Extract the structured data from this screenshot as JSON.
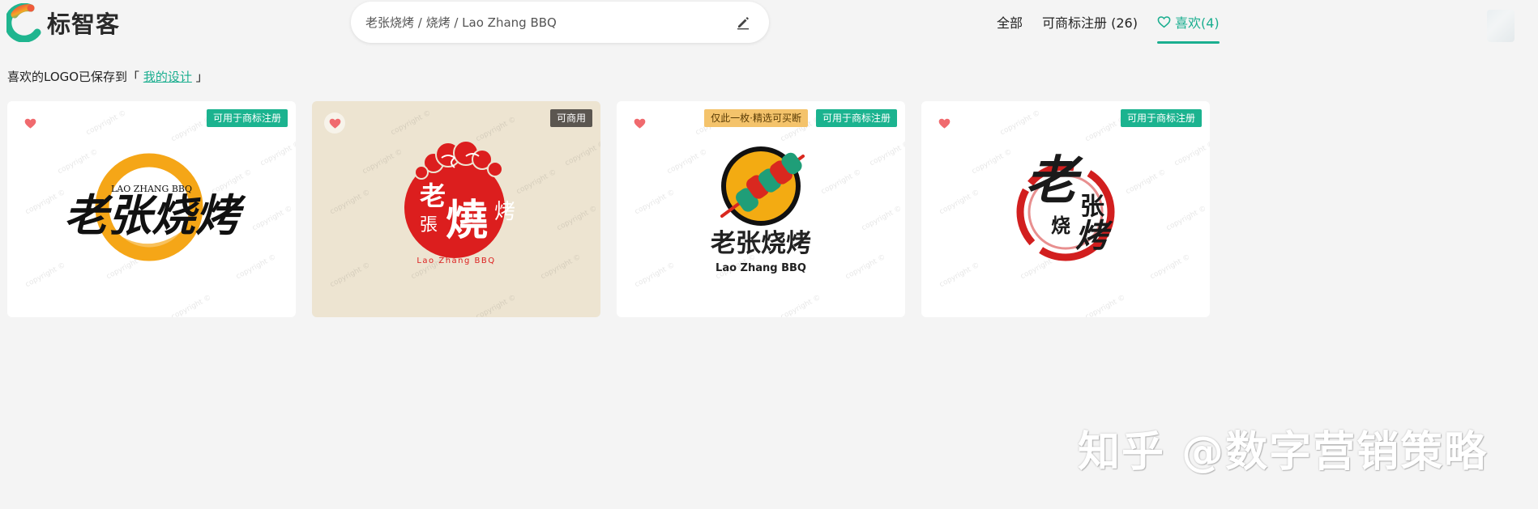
{
  "brand": {
    "name": "标智客",
    "icon": "brand-logo-mark",
    "accent_color": "#1aae8f"
  },
  "search": {
    "query": "老张烧烤 / 烧烤 / Lao Zhang BBQ",
    "action_icon": "edit-icon"
  },
  "nav": {
    "all_label": "全部",
    "trademark_label": "可商标注册 (26)",
    "favorites_label": "喜欢(4)",
    "active": "favorites"
  },
  "notice": {
    "prefix": "喜欢的LOGO已保存到「 ",
    "link_label": "我的设计",
    "suffix": " 」"
  },
  "cards": [
    {
      "badges": [
        "可用于商标注册"
      ],
      "logo": {
        "chinese": "老张烧烤",
        "english": "LAO ZHANG BBQ",
        "style": "calligraphy-on-orange-ring"
      }
    },
    {
      "badges": [
        "可商用"
      ],
      "logo": {
        "chinese_top": "老",
        "chinese_mid": "張",
        "chinese_main": "燒",
        "chinese_side": "烤",
        "english": "Lao Zhang BBQ",
        "style": "red-circle-with-clouds"
      }
    },
    {
      "badges": [
        "仅此一枚·精选可买断",
        "可用于商标注册"
      ],
      "logo": {
        "chinese": "老张烧烤",
        "english": "Lao Zhang BBQ",
        "style": "skewer-circle"
      }
    },
    {
      "badges": [
        "可用于商标注册"
      ],
      "logo": {
        "chinese_big": "老",
        "chinese_small_1": "张",
        "chinese_small_2": "烧",
        "chinese_small_3": "烤",
        "style": "calligraphy-on-red-brush-circle"
      }
    }
  ],
  "watermark_text": "copyright ©",
  "overlay_watermark": "知乎 @数字营销策略",
  "colors": {
    "like": "#f06a6e",
    "badge_green": "#1bb38f",
    "badge_dark": "#5b5650",
    "badge_gold": "#f4c36b"
  }
}
